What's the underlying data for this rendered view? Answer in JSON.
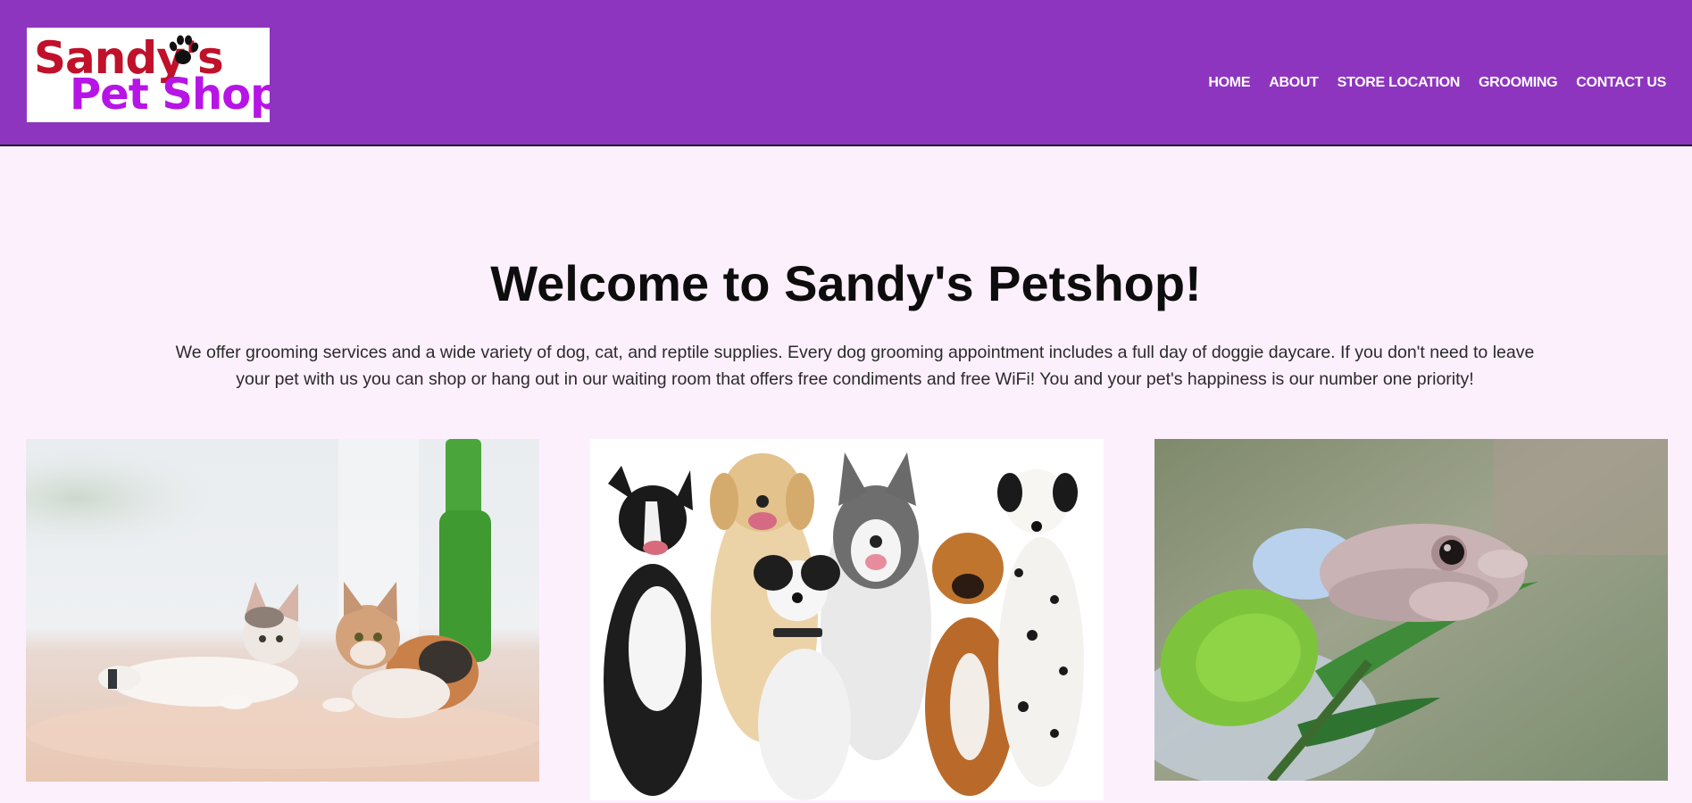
{
  "header": {
    "logo": {
      "line1": "Sandy's",
      "line2": "Pet Shop"
    },
    "nav": [
      {
        "label": "HOME"
      },
      {
        "label": "ABOUT"
      },
      {
        "label": "STORE LOCATION"
      },
      {
        "label": "GROOMING"
      },
      {
        "label": "CONTACT US"
      }
    ],
    "background_color": "#8e35c0"
  },
  "main": {
    "title": "Welcome to Sandy's Petshop!",
    "description": "We offer grooming services and a wide variety of dog, cat, and reptile supplies. Every dog grooming appointment includes a full day of doggie daycare. If you don't need to leave your pet with us you can shop or hang out in our waiting room that offers free condiments and free WiFi! You and your pet's happiness is our number one priority!",
    "gallery": [
      {
        "subject": "two kittens lying on a wooden floor"
      },
      {
        "subject": "group of five dogs sitting together"
      },
      {
        "subject": "tree frog on a green leaf"
      }
    ]
  },
  "colors": {
    "page_background": "#fdf0fd",
    "logo_red": "#c0102a",
    "logo_purple": "#b714e6"
  }
}
